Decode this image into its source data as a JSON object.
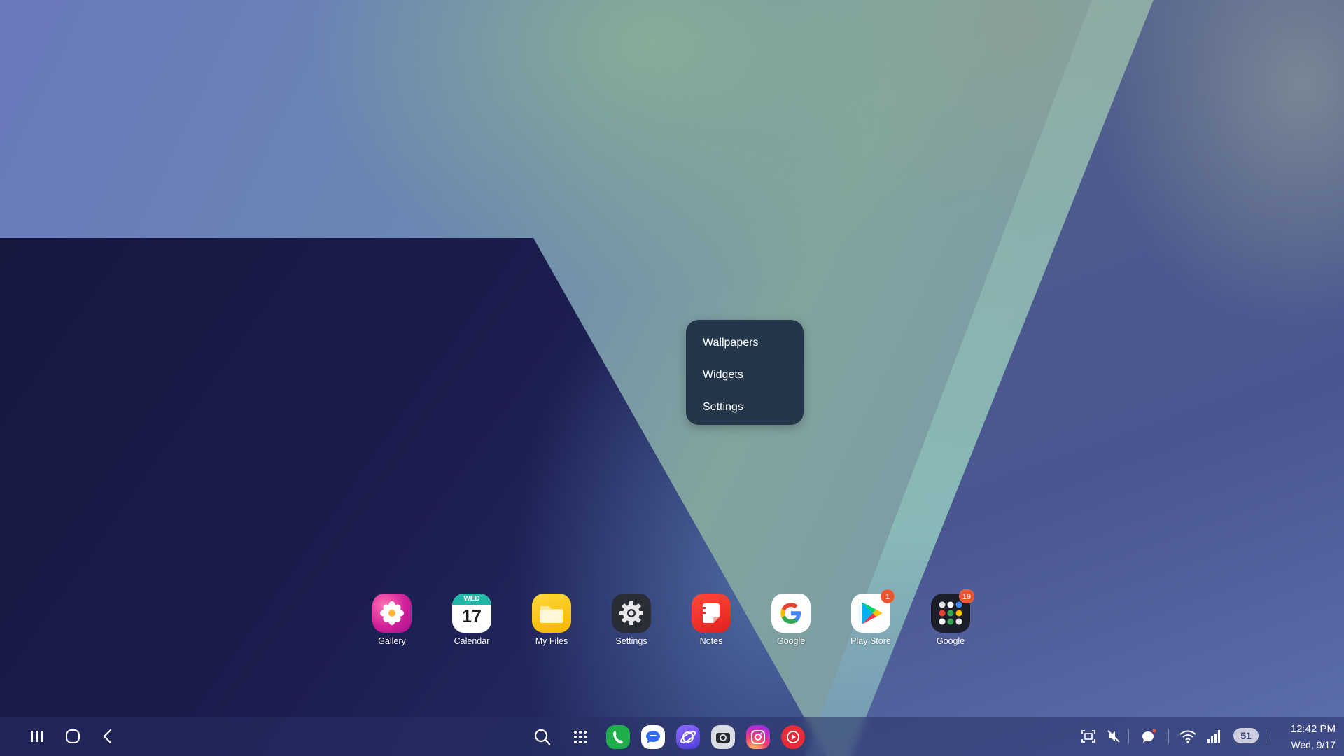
{
  "context_menu": {
    "items": [
      {
        "label": "Wallpapers"
      },
      {
        "label": "Widgets"
      },
      {
        "label": "Settings"
      }
    ]
  },
  "apps": [
    {
      "label": "Gallery",
      "icon": "gallery-flower-icon"
    },
    {
      "label": "Calendar",
      "icon": "calendar-icon",
      "day_name": "WED",
      "day_number": "17"
    },
    {
      "label": "My Files",
      "icon": "folder-icon"
    },
    {
      "label": "Settings",
      "icon": "gear-icon"
    },
    {
      "label": "Notes",
      "icon": "notes-icon"
    },
    {
      "label": "Google",
      "icon": "google-g-icon"
    },
    {
      "label": "Play Store",
      "icon": "play-store-icon",
      "badge": "1"
    },
    {
      "label": "Google",
      "icon": "google-apps-folder-icon",
      "badge": "19"
    }
  ],
  "taskbar": {
    "nav": [
      "recents-icon",
      "home-icon",
      "back-icon"
    ],
    "apps": [
      "search-icon",
      "app-drawer-icon",
      "phone-icon",
      "messages-icon",
      "internet-icon",
      "camera-icon",
      "instagram-icon",
      "youtube-music-icon"
    ],
    "tray": [
      "screen-capture-icon",
      "mute-icon",
      "notification-icon",
      "wifi-icon",
      "signal-icon"
    ],
    "battery": "51",
    "time": "12:42 PM",
    "date": "Wed, 9/17"
  },
  "colors": {
    "menu_bg": "#23364a",
    "badge": "#e8542f"
  }
}
